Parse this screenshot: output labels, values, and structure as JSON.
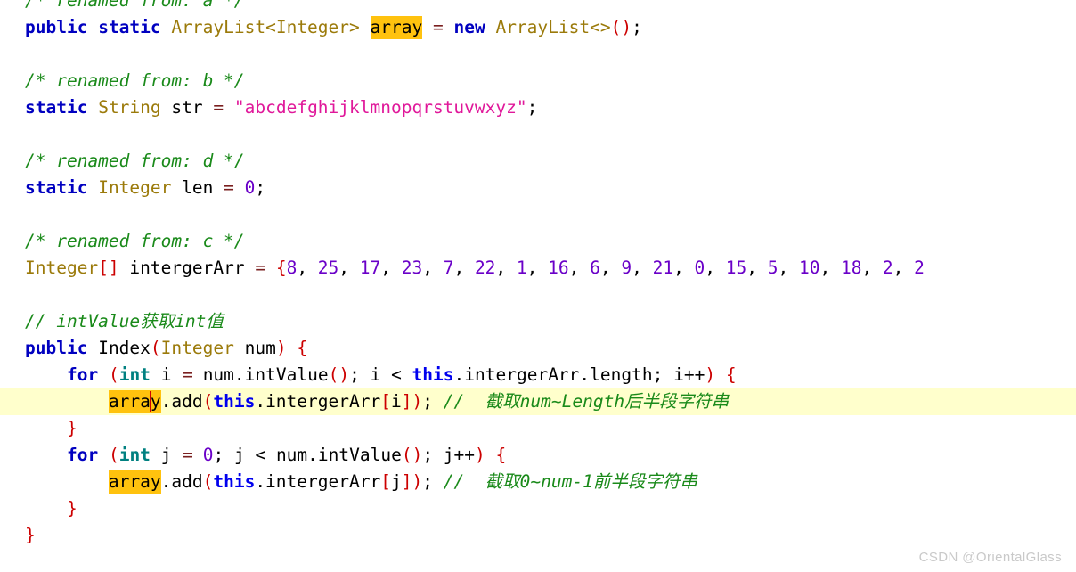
{
  "editor": {
    "language": "java",
    "theme_background": "#ffffff",
    "current_line_background": "#ffffcc",
    "occurrence_highlight": "#ffc20e",
    "caret_color": "#d00000",
    "colors": {
      "keyword": "#0000c0",
      "type": "#9b7a0a",
      "primitive": "#008080",
      "number": "#6a00c8",
      "string": "#e0189a",
      "comment": "#1a8a1a",
      "punctuation": "#cc0000",
      "this_keyword": "#0000ee",
      "operator": "#7a1f1f",
      "plain": "#000000"
    }
  },
  "code": {
    "l01_comment": "/* renamed from: a */",
    "l02": {
      "kw_public": "public",
      "kw_static": "static",
      "type_arraylist": "ArrayList",
      "angle_open": "<",
      "type_integer": "Integer",
      "angle_close": ">",
      "ident_array": "array",
      "op_assign": "=",
      "kw_new": "new",
      "type_arraylist2": "ArrayList",
      "diamond": "<>",
      "paren_open": "(",
      "paren_close": ")",
      "semi": ";"
    },
    "l04_comment": "/* renamed from: b */",
    "l05": {
      "kw_static": "static",
      "type_string": "String",
      "ident_str": "str",
      "op_assign": "=",
      "string_literal": "\"abcdefghijklmnopqrstuvwxyz\"",
      "semi": ";"
    },
    "l07_comment": "/* renamed from: d */",
    "l08": {
      "kw_static": "static",
      "type_integer": "Integer",
      "ident_len": "len",
      "op_assign": "=",
      "num_zero": "0",
      "semi": ";"
    },
    "l10_comment": "/* renamed from: c */",
    "l11": {
      "type_integer": "Integer",
      "brackets": "[]",
      "ident_arr": "intergerArr",
      "op_assign": "=",
      "brace_open": "{",
      "values": [
        8,
        25,
        17,
        23,
        7,
        22,
        1,
        16,
        6,
        9,
        21,
        0,
        15,
        5,
        10,
        18,
        2,
        2
      ],
      "truncated": true
    },
    "l13_comment": "// intValue获取int值",
    "l14": {
      "kw_public": "public",
      "ident_ctor": "Index",
      "paren_open": "(",
      "type_integer": "Integer",
      "param_num": "num",
      "paren_close": ")",
      "brace_open": "{"
    },
    "l15": {
      "kw_for": "for",
      "paren_open": "(",
      "prim_int": "int",
      "var_i": "i",
      "op_assign": "=",
      "expr_init": "num.intValue",
      "call_parens": "()",
      "semi1": ";",
      "var_i2": "i",
      "op_lt": "<",
      "kw_this": "this",
      "field_length": ".intergerArr.length",
      "semi2": ";",
      "incr": "i++",
      "paren_close": ")",
      "brace_open": "{"
    },
    "l16": {
      "ident_array": "array",
      "dot_add": ".add",
      "paren_open": "(",
      "kw_this": "this",
      "field_arr": ".intergerArr",
      "bracket_open": "[",
      "idx": "i",
      "bracket_close": "]",
      "paren_close": ")",
      "semi": ";",
      "comment": "//  截取num~Length后半段字符串",
      "is_current_line": true,
      "caret_after": "arra"
    },
    "l17_close": "}",
    "l18": {
      "kw_for": "for",
      "paren_open": "(",
      "prim_int": "int",
      "var_j": "j",
      "op_assign": "=",
      "num_zero": "0",
      "semi1": ";",
      "var_j2": "j",
      "op_lt": "<",
      "expr_cond": "num.intValue",
      "call_parens": "()",
      "semi2": ";",
      "incr": "j++",
      "paren_close": ")",
      "brace_open": "{"
    },
    "l19": {
      "ident_array": "array",
      "dot_add": ".add",
      "paren_open": "(",
      "kw_this": "this",
      "field_arr": ".intergerArr",
      "bracket_open": "[",
      "idx": "j",
      "bracket_close": "]",
      "paren_close": ")",
      "semi": ";",
      "comment": "//  截取0~num-1前半段字符串"
    },
    "l20_close": "}",
    "l21_close": "}"
  },
  "watermark": {
    "text": "CSDN @OrientalGlass"
  }
}
